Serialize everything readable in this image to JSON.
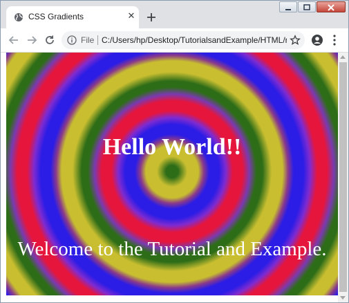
{
  "browser": {
    "tab": {
      "title": "CSS Gradients",
      "favicon": "globe-icon",
      "close_icon": "close-icon"
    },
    "new_tab_icon": "plus-icon",
    "window_controls": [
      "minimize-icon",
      "maximize-icon",
      "close-window-icon"
    ],
    "toolbar": {
      "back_icon": "back-arrow-icon",
      "forward_icon": "forward-arrow-icon",
      "reload_icon": "reload-icon",
      "omnibox": {
        "info_icon": "info-icon",
        "scheme_label": "File",
        "url": "C:/Users/hp/Desktop/TutorialsandExample/HTML/r..."
      },
      "bookmark_icon": "star-icon",
      "profile_icon": "profile-icon",
      "menu_icon": "kebab-menu-icon"
    }
  },
  "page": {
    "heading": "Hello World!!",
    "paragraph": "Welcome to the Tutorial and Example.",
    "gradient_colors": [
      "#2e6d18",
      "#c8be30",
      "#2b1ce6",
      "#e6153c",
      "#7f2bd0"
    ],
    "text_color": "#ffffff"
  }
}
